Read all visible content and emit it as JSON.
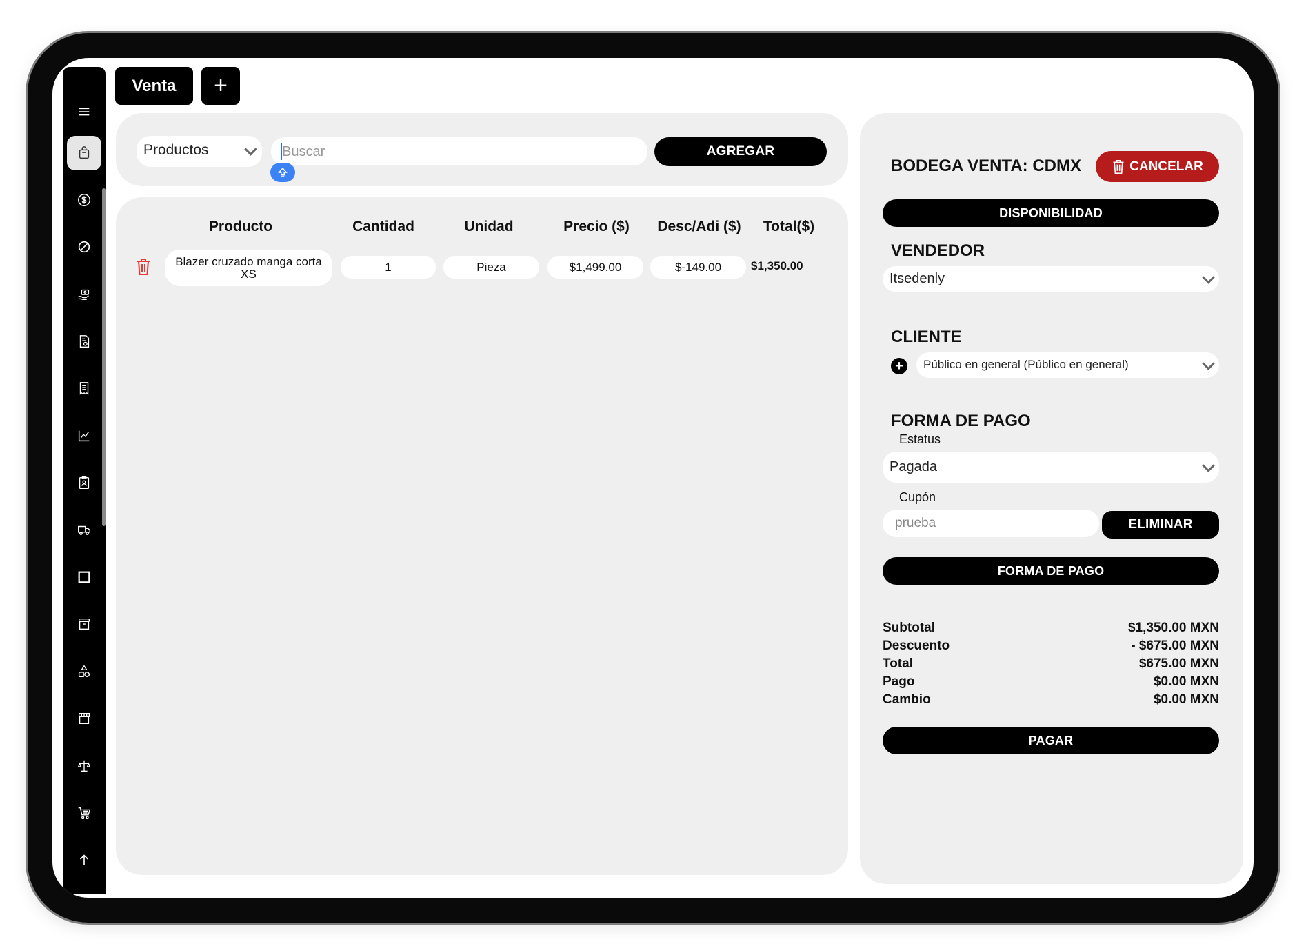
{
  "sidebar": {
    "icons": [
      "menu-icon",
      "shopping-bag-icon",
      "dollar-icon",
      "ban-icon",
      "hand-money-icon",
      "invoice-icon",
      "receipt-icon",
      "chart-line-icon",
      "clipboard-icon",
      "truck-icon",
      "square-icon",
      "archive-icon",
      "shapes-icon",
      "store-icon",
      "scale-icon",
      "cart-list-icon",
      "arrow-up-icon"
    ]
  },
  "tabs": {
    "venta_label": "Venta",
    "add_label": "+"
  },
  "search": {
    "category_selected": "Productos",
    "placeholder": "Buscar",
    "add_button": "AGREGAR"
  },
  "table": {
    "headers": [
      "Producto",
      "Cantidad",
      "Unidad",
      "Precio ($)",
      "Desc/Adi ($)",
      "Total($)"
    ],
    "rows": [
      {
        "product_line1": "Blazer cruzado manga corta",
        "product_line2": "XS",
        "quantity": "1",
        "unit": "Pieza",
        "price": "$1,499.00",
        "discount": "$-149.00",
        "total": "$1,350.00"
      }
    ]
  },
  "order": {
    "warehouse_label": "BODEGA VENTA: CDMX",
    "cancel_button": "CANCELAR",
    "availability_button": "DISPONIBILIDAD",
    "seller_title": "VENDEDOR",
    "seller_selected": "Itsedenly",
    "client_title": "CLIENTE",
    "client_selected": "Público en general (Público en general)",
    "payment_title": "FORMA DE PAGO",
    "status_label": "Estatus",
    "status_selected": "Pagada",
    "coupon_label": "Cupón",
    "coupon_value": "prueba",
    "remove_button": "ELIMINAR",
    "payment_method_button": "FORMA DE PAGO",
    "summary": {
      "subtotal_label": "Subtotal",
      "subtotal_value": "$1,350.00 MXN",
      "discount_label": "Descuento",
      "discount_value": "- $675.00 MXN",
      "total_label": "Total",
      "total_value": "$675.00 MXN",
      "payment_label": "Pago",
      "payment_value": "$0.00 MXN",
      "change_label": "Cambio",
      "change_value": "$0.00 MXN"
    },
    "pay_button": "PAGAR"
  },
  "colors": {
    "accent_red": "#b71c1c",
    "delete_red": "#e53935",
    "blue_badge": "#3b82f6",
    "panel_gray": "#efefef"
  }
}
